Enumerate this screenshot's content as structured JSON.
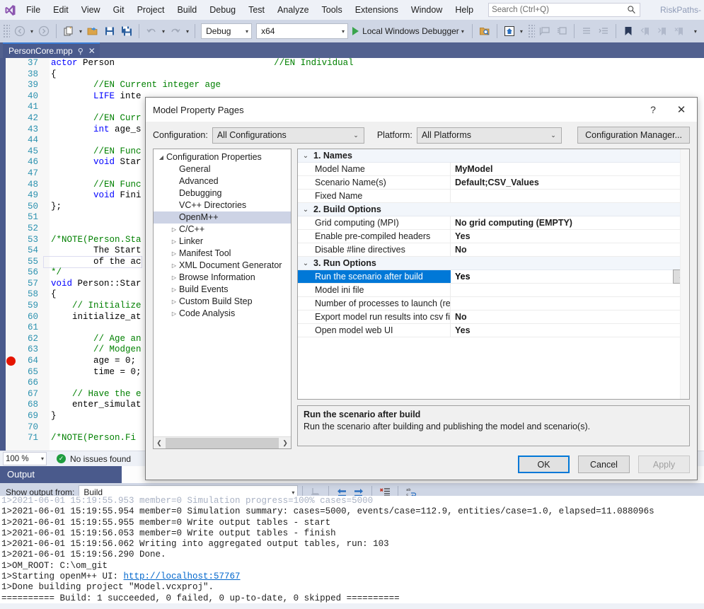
{
  "menubar": {
    "logo_icon": "visual-studio-logo",
    "items": [
      "File",
      "Edit",
      "View",
      "Git",
      "Project",
      "Build",
      "Debug",
      "Test",
      "Analyze",
      "Tools",
      "Extensions",
      "Window",
      "Help"
    ],
    "search_placeholder": "Search (Ctrl+Q)",
    "search_value": "",
    "search_icon": "search-icon",
    "project_label": "RiskPaths-"
  },
  "toolbar": {
    "nav_back_icon": "navigate-back-icon",
    "nav_forward_icon": "navigate-forward-icon",
    "new_item_icon": "new-item-icon",
    "open_icon": "open-folder-icon",
    "save_icon": "save-icon",
    "save_all_icon": "save-all-icon",
    "undo_icon": "undo-icon",
    "redo_icon": "redo-icon",
    "config_combo": "Debug",
    "platform_combo": "x64",
    "run_label": "Local Windows Debugger",
    "run_icon": "play-icon",
    "find_in_files_icon": "find-in-files-icon",
    "solution_explorer_icon": "home-icon",
    "comment_icon": "comment-selection-icon",
    "uncomment_icon": "uncomment-selection-icon",
    "indent_icon": "increase-indent-icon",
    "outdent_icon": "decrease-indent-icon",
    "bookmark_icon": "bookmark-icon",
    "prev_bookmark_icon": "previous-bookmark-icon",
    "next_bookmark_icon": "next-bookmark-icon",
    "clear_bookmark_icon": "clear-bookmark-icon",
    "overflow_icon": "toolbar-overflow-icon"
  },
  "editor": {
    "tab_title": "PersonCore.mpp",
    "tab_pin_icon": "pin-icon",
    "tab_close_icon": "close-icon",
    "breakpoint_icon": "breakpoint-icon",
    "breakpoint_line": 64,
    "lines": [
      {
        "n": 37,
        "text": "actor Person                              //EN Individual"
      },
      {
        "n": 38,
        "text": "{"
      },
      {
        "n": 39,
        "text": "        //EN Current integer age"
      },
      {
        "n": 40,
        "text": "        LIFE inte"
      },
      {
        "n": 41,
        "text": ""
      },
      {
        "n": 42,
        "text": "        //EN Curr"
      },
      {
        "n": 43,
        "text": "        int age_s"
      },
      {
        "n": 44,
        "text": ""
      },
      {
        "n": 45,
        "text": "        //EN Func"
      },
      {
        "n": 46,
        "text": "        void Star"
      },
      {
        "n": 47,
        "text": ""
      },
      {
        "n": 48,
        "text": "        //EN Func"
      },
      {
        "n": 49,
        "text": "        void Fini"
      },
      {
        "n": 50,
        "text": "};"
      },
      {
        "n": 51,
        "text": ""
      },
      {
        "n": 52,
        "text": ""
      },
      {
        "n": 53,
        "text": "/*NOTE(Person.Sta"
      },
      {
        "n": 54,
        "text": "        The Start"
      },
      {
        "n": 55,
        "text": "        of the ac"
      },
      {
        "n": 56,
        "text": "*/"
      },
      {
        "n": 57,
        "text": "void Person::Star"
      },
      {
        "n": 58,
        "text": "{"
      },
      {
        "n": 59,
        "text": "    // Initialize"
      },
      {
        "n": 60,
        "text": "    initialize_at"
      },
      {
        "n": 61,
        "text": ""
      },
      {
        "n": 62,
        "text": "        // Age an"
      },
      {
        "n": 63,
        "text": "        // Modgen"
      },
      {
        "n": 64,
        "text": "        age = 0;"
      },
      {
        "n": 65,
        "text": "        time = 0;"
      },
      {
        "n": 66,
        "text": ""
      },
      {
        "n": 67,
        "text": "    // Have the e"
      },
      {
        "n": 68,
        "text": "    enter_simulat"
      },
      {
        "n": 69,
        "text": "}"
      },
      {
        "n": 70,
        "text": ""
      },
      {
        "n": 71,
        "text": "/*NOTE(Person.Fi"
      }
    ],
    "status": {
      "zoom": "100 %",
      "issues_icon": "check-circle-icon",
      "issues_text": "No issues found"
    }
  },
  "output": {
    "title": "Output",
    "show_output_from_label": "Show output from:",
    "show_output_from_value": "Build",
    "toolbar_icons": {
      "find_message_icon": "find-message-icon",
      "go_to_previous_icon": "go-to-previous-message-icon",
      "go_to_next_icon": "go-to-next-message-icon",
      "clear_all_icon": "clear-all-icon",
      "toggle_word_wrap_icon": "toggle-word-wrap-icon"
    },
    "lines": [
      "1>2021-06-01 15:19:55.953 member=0 Simulation progress=100% cases=5000",
      "1>2021-06-01 15:19:55.954 member=0 Simulation summary: cases=5000, events/case=112.9, entities/case=1.0, elapsed=11.088096s",
      "1>2021-06-01 15:19:55.955 member=0 Write output tables - start",
      "1>2021-06-01 15:19:56.053 member=0 Write output tables - finish",
      "1>2021-06-01 15:19:56.062 Writing into aggregated output tables, run: 103",
      "1>2021-06-01 15:19:56.290 Done.",
      "1>OM_ROOT: C:\\om_git",
      "1>Starting openM++ UI: ",
      "1>Done building project \"Model.vcxproj\".",
      "========== Build: 1 succeeded, 0 failed, 0 up-to-date, 0 skipped =========="
    ],
    "link_text": "http://localhost:57767"
  },
  "dialog": {
    "title": "Model Property Pages",
    "help_icon": "help-icon",
    "close_icon": "close-icon",
    "configuration_label": "Configuration:",
    "configuration_value": "All Configurations",
    "platform_label": "Platform:",
    "platform_value": "All Platforms",
    "configuration_manager_label": "Configuration Manager...",
    "tree": [
      {
        "label": "Configuration Properties",
        "twisty": "expanded",
        "indent": 0,
        "selected": false
      },
      {
        "label": "General",
        "twisty": "none",
        "indent": 1,
        "selected": false
      },
      {
        "label": "Advanced",
        "twisty": "none",
        "indent": 1,
        "selected": false
      },
      {
        "label": "Debugging",
        "twisty": "none",
        "indent": 1,
        "selected": false
      },
      {
        "label": "VC++ Directories",
        "twisty": "none",
        "indent": 1,
        "selected": false
      },
      {
        "label": "OpenM++",
        "twisty": "none",
        "indent": 1,
        "selected": true
      },
      {
        "label": "C/C++",
        "twisty": "collapsed",
        "indent": 1,
        "selected": false
      },
      {
        "label": "Linker",
        "twisty": "collapsed",
        "indent": 1,
        "selected": false
      },
      {
        "label": "Manifest Tool",
        "twisty": "collapsed",
        "indent": 1,
        "selected": false
      },
      {
        "label": "XML Document Generator",
        "twisty": "collapsed",
        "indent": 1,
        "selected": false
      },
      {
        "label": "Browse Information",
        "twisty": "collapsed",
        "indent": 1,
        "selected": false
      },
      {
        "label": "Build Events",
        "twisty": "collapsed",
        "indent": 1,
        "selected": false
      },
      {
        "label": "Custom Build Step",
        "twisty": "collapsed",
        "indent": 1,
        "selected": false
      },
      {
        "label": "Code Analysis",
        "twisty": "collapsed",
        "indent": 1,
        "selected": false
      }
    ],
    "grid": [
      {
        "type": "section",
        "label": "1. Names",
        "chevron": "expanded"
      },
      {
        "type": "row",
        "key": "Model Name",
        "value": "MyModel",
        "selected": false
      },
      {
        "type": "row",
        "key": "Scenario Name(s)",
        "value": "Default;CSV_Values",
        "selected": false
      },
      {
        "type": "row",
        "key": "Fixed Name",
        "value": "",
        "selected": false
      },
      {
        "type": "section",
        "label": "2. Build Options",
        "chevron": "expanded"
      },
      {
        "type": "row",
        "key": "Grid computing (MPI)",
        "value": "No grid computing (EMPTY)",
        "selected": false
      },
      {
        "type": "row",
        "key": "Enable pre-compiled headers",
        "value": "Yes",
        "selected": false
      },
      {
        "type": "row",
        "key": "Disable #line directives",
        "value": "No",
        "selected": false
      },
      {
        "type": "section",
        "label": "3. Run Options",
        "chevron": "expanded"
      },
      {
        "type": "row",
        "key": "Run the scenario after build",
        "value": "Yes",
        "selected": true
      },
      {
        "type": "row",
        "key": "Model ini file",
        "value": "",
        "selected": false
      },
      {
        "type": "row",
        "key": "Number of processes to launch (require",
        "value": "",
        "selected": false
      },
      {
        "type": "row",
        "key": "Export model run results into csv files",
        "value": "No",
        "selected": false
      },
      {
        "type": "row",
        "key": "Open model web UI",
        "value": "Yes",
        "selected": false
      }
    ],
    "description_title": "Run the scenario after build",
    "description_body": "Run the scenario after building and publishing the model and scenario(s).",
    "ok_label": "OK",
    "cancel_label": "Cancel",
    "apply_label": "Apply"
  }
}
